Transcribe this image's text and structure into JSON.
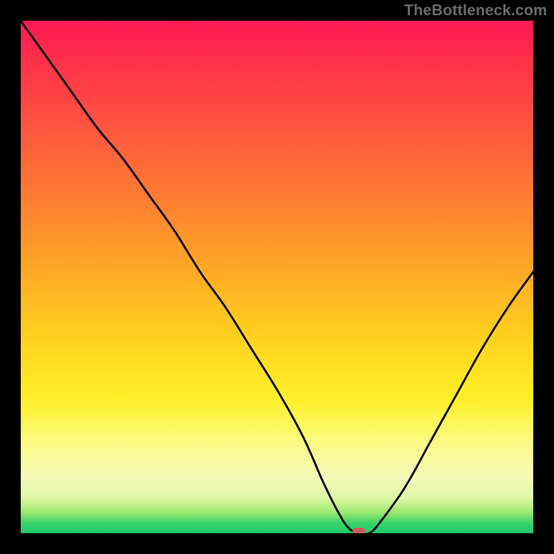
{
  "watermark": "TheBottleneck.com",
  "colors": {
    "frame_bg": "#000000",
    "curve": "#000000",
    "marker": "#cf5a5a",
    "gradient_stops": [
      "#ff1a53",
      "#ff2e4b",
      "#ff5440",
      "#ff7b33",
      "#ffa726",
      "#ffd21e",
      "#fff028",
      "#fbfb8a",
      "#f3f9b8",
      "#e0f8a8",
      "#9be86e",
      "#38d36a",
      "#1ec96a"
    ]
  },
  "chart_data": {
    "type": "line",
    "title": "",
    "xlabel": "",
    "ylabel": "",
    "xlim": [
      0,
      100
    ],
    "ylim": [
      0,
      100
    ],
    "series": [
      {
        "name": "bottleneck-curve",
        "x": [
          0,
          5,
          10,
          15,
          20,
          25,
          30,
          35,
          40,
          45,
          50,
          55,
          59,
          62,
          64,
          66,
          68,
          70,
          75,
          80,
          85,
          90,
          95,
          100
        ],
        "y": [
          100,
          93,
          86,
          79,
          73,
          66,
          59,
          51,
          44,
          36,
          28,
          19,
          10,
          4,
          1,
          0,
          0,
          2,
          9,
          18,
          27,
          36,
          44,
          51
        ]
      }
    ],
    "annotations": [
      {
        "name": "optimal-marker",
        "x": 66,
        "y": 0
      }
    ],
    "notes": "y represents bottleneck severity percent (top=100 worst, bottom=0 optimal). Curve descends from top-left to a flat minimum near x≈64–68, then rises toward the right with a gentler slope."
  }
}
